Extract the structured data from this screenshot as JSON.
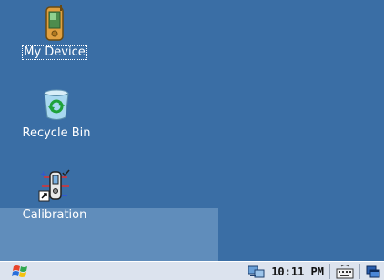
{
  "desktop": {
    "background_color": "#3a6ea5",
    "icons": [
      {
        "label": "My Device",
        "icon": "pocket-pc-icon",
        "selected": true
      },
      {
        "label": "Recycle Bin",
        "icon": "recycle-bin-icon",
        "selected": false
      },
      {
        "label": "Calibration",
        "icon": "calibration-shortcut-icon",
        "selected": false
      }
    ]
  },
  "taskbar": {
    "start_icon": "windows-flag-icon",
    "tray": {
      "network_icon": "network-connection-icon",
      "clock": "10:11 PM",
      "keyboard_icon": "input-panel-keyboard-icon",
      "desktop_icon": "show-desktop-icon"
    }
  }
}
